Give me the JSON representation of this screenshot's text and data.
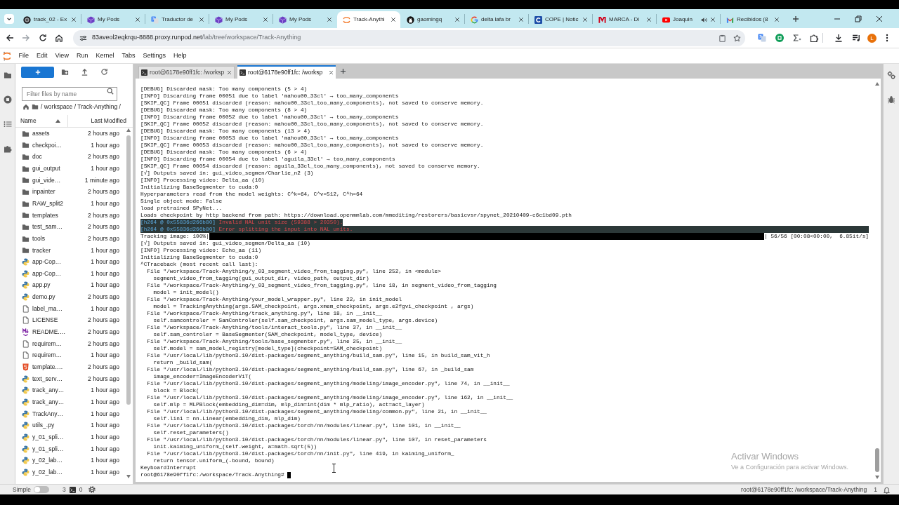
{
  "browser": {
    "tabs": [
      {
        "title": "track_02 - Ex",
        "kind": "disc",
        "selected": false,
        "audio": false
      },
      {
        "title": "My Pods",
        "kind": "cube",
        "selected": false,
        "audio": false
      },
      {
        "title": "Traductor de",
        "kind": "translate",
        "selected": false,
        "audio": false
      },
      {
        "title": "My Pods",
        "kind": "cube",
        "selected": false,
        "audio": false
      },
      {
        "title": "My Pods",
        "kind": "cube",
        "selected": false,
        "audio": false
      },
      {
        "title": "Track-Anythi",
        "kind": "arcs",
        "selected": true,
        "audio": false
      },
      {
        "title": "gaomingq",
        "kind": "cat",
        "selected": false,
        "audio": false
      },
      {
        "title": "delta lafa br",
        "kind": "g",
        "selected": false,
        "audio": false
      },
      {
        "title": "COPE | Notic",
        "kind": "c",
        "selected": false,
        "audio": false
      },
      {
        "title": "MARCA - Di",
        "kind": "m",
        "selected": false,
        "audio": false
      },
      {
        "title": "Joaquin",
        "kind": "play",
        "selected": false,
        "audio": true
      },
      {
        "title": "Recibidos (8",
        "kind": "envelope",
        "selected": false,
        "audio": false
      }
    ],
    "address": {
      "host": "83aveol2eqkrqu-8888.proxy.runpod.net",
      "path": "/lab/tree/workspace/Track-Anything"
    },
    "profile_initial": "L"
  },
  "menu": [
    "File",
    "Edit",
    "View",
    "Run",
    "Kernel",
    "Tabs",
    "Settings",
    "Help"
  ],
  "file_browser": {
    "filter_placeholder": "Filter files by name",
    "breadcrumb": "/ workspace / Track-Anything /",
    "columns": [
      {
        "label": "Name",
        "sorted": true
      },
      {
        "label": "Last Modified",
        "sorted": false
      }
    ],
    "files": [
      {
        "name": "assets",
        "kind": "folder",
        "modified": "2 hours ago"
      },
      {
        "name": "checkpoi…",
        "kind": "folder",
        "modified": "1 hour ago"
      },
      {
        "name": "doc",
        "kind": "folder",
        "modified": "2 hours ago"
      },
      {
        "name": "gui_output",
        "kind": "folder",
        "modified": "1 hour ago"
      },
      {
        "name": "gui_vide…",
        "kind": "folder",
        "modified": "1 minute ago"
      },
      {
        "name": "inpainter",
        "kind": "folder",
        "modified": "2 hours ago"
      },
      {
        "name": "RAW_split2",
        "kind": "folder",
        "modified": "1 hour ago"
      },
      {
        "name": "templates",
        "kind": "folder",
        "modified": "2 hours ago"
      },
      {
        "name": "test_sam…",
        "kind": "folder",
        "modified": "2 hours ago"
      },
      {
        "name": "tools",
        "kind": "folder",
        "modified": "2 hours ago"
      },
      {
        "name": "tracker",
        "kind": "folder",
        "modified": "1 hour ago"
      },
      {
        "name": "app-Cop…",
        "kind": "python",
        "modified": "1 hour ago"
      },
      {
        "name": "app-Cop…",
        "kind": "python",
        "modified": "1 hour ago"
      },
      {
        "name": "app.py",
        "kind": "python",
        "modified": "1 hour ago"
      },
      {
        "name": "demo.py",
        "kind": "python",
        "modified": "2 hours ago"
      },
      {
        "name": "label_ma…",
        "kind": "text",
        "modified": "1 hour ago"
      },
      {
        "name": "LICENSE",
        "kind": "text",
        "modified": "2 hours ago"
      },
      {
        "name": "README.…",
        "kind": "markdown",
        "modified": "2 hours ago"
      },
      {
        "name": "requirem…",
        "kind": "text",
        "modified": "2 hours ago"
      },
      {
        "name": "requirem…",
        "kind": "text",
        "modified": "1 hour ago"
      },
      {
        "name": "template.…",
        "kind": "html",
        "modified": "2 hours ago"
      },
      {
        "name": "text_serv…",
        "kind": "python",
        "modified": "2 hours ago"
      },
      {
        "name": "track_any…",
        "kind": "python",
        "modified": "1 hour ago"
      },
      {
        "name": "track_any…",
        "kind": "python",
        "modified": "1 hour ago"
      },
      {
        "name": "TrackAny…",
        "kind": "python",
        "modified": "1 hour ago"
      },
      {
        "name": "utils_.py",
        "kind": "python",
        "modified": "1 hour ago"
      },
      {
        "name": "y_01_spli…",
        "kind": "python",
        "modified": "1 hour ago"
      },
      {
        "name": "y_01_spli…",
        "kind": "python",
        "modified": "1 hour ago"
      },
      {
        "name": "y_02_lab…",
        "kind": "python",
        "modified": "1 hour ago"
      },
      {
        "name": "y_02_lab…",
        "kind": "python",
        "modified": "1 hour ago"
      }
    ]
  },
  "terminal_tabs": [
    {
      "title": "root@6178e90ff1fc: /worksp",
      "selected": false
    },
    {
      "title": "root@6178e90ff1fc: /worksp",
      "selected": true
    }
  ],
  "terminal": {
    "lines": [
      {
        "kind": "text",
        "text": "[DEBUG] Discarded mask: Too many components (5 > 4)"
      },
      {
        "kind": "text",
        "text": "[INFO] Discarding frame 00051 due to label 'mahou00_33cl' → too_many_components"
      },
      {
        "kind": "text",
        "text": "[SKIP_QC] Frame 00051 discarded (reason: mahou00_33cl_too_many_components), not saved to conserve memory."
      },
      {
        "kind": "text",
        "text": "[DEBUG] Discarded mask: Too many components (8 > 4)"
      },
      {
        "kind": "text",
        "text": "[INFO] Discarding frame 00052 due to label 'mahou00_33cl' → too_many_components"
      },
      {
        "kind": "text",
        "text": "[SKIP_QC] Frame 00052 discarded (reason: mahou00_33cl_too_many_components), not saved to conserve memory."
      },
      {
        "kind": "text",
        "text": "[DEBUG] Discarded mask: Too many components (13 > 4)"
      },
      {
        "kind": "text",
        "text": "[INFO] Discarding frame 00053 due to label 'mahou00_33cl' → too_many_components"
      },
      {
        "kind": "text",
        "text": "[SKIP_QC] Frame 00053 discarded (reason: mahou00_33cl_too_many_components), not saved to conserve memory."
      },
      {
        "kind": "text",
        "text": "[DEBUG] Discarded mask: Too many components (6 > 4)"
      },
      {
        "kind": "text",
        "text": "[INFO] Discarding frame 00054 due to label 'aguila_33cl' → too_many_components"
      },
      {
        "kind": "text",
        "text": "[SKIP_QC] Frame 00054 discarded (reason: aguila_33cl_too_many_components), not saved to conserve memory."
      },
      {
        "kind": "text",
        "text": "[√] Outputs saved in: gui_video_segmen/Charlie_n2 (3)"
      },
      {
        "kind": "text",
        "text": "[INFO] Processing video: Delta_aa (10)"
      },
      {
        "kind": "text",
        "text": "Initializing BaseSegmenter to cuda:0"
      },
      {
        "kind": "text",
        "text": "Hyperparameters read from the model weights: C^k=64, C^v=512, C^h=64"
      },
      {
        "kind": "text",
        "text": "Single object mode: False"
      },
      {
        "kind": "text",
        "text": "load pretrained SPyNet..."
      },
      {
        "kind": "text",
        "text": "Loads checkpoint by http backend from path: https://download.openmmlab.com/mmediting/restorers/basicvsr/spynet_20210409-c6c1bd09.pth"
      },
      {
        "kind": "error",
        "prefix": "[h264 @ 0x55836d266b80]",
        "message": "Invalid NAL unit size (59388 > 20350).",
        "band_full_width": false
      },
      {
        "kind": "error",
        "prefix": "[h264 @ 0x55836d266b80]",
        "message": "Error splitting the input into NAL units.",
        "band_full_width": true
      },
      {
        "kind": "progress",
        "label": "Tracking image: 100%|",
        "level": 1,
        "stats": "| 56/56 [00:08<00:00,  6.85it/s]"
      },
      {
        "kind": "text",
        "text": "[√] Outputs saved in: gui_video_segmen/Delta_aa (10)"
      },
      {
        "kind": "text",
        "text": "[INFO] Processing video: Echo_aa (11)"
      },
      {
        "kind": "text",
        "text": "Initializing BaseSegmenter to cuda:0"
      },
      {
        "kind": "text",
        "text": "^CTraceback (most recent call last):"
      },
      {
        "kind": "text",
        "text": "  File \"/workspace/Track-Anything/y_03_segment_video_from_tagging.py\", line 252, in <module>"
      },
      {
        "kind": "text",
        "text": "    segment_video_from_tagging(gui_output_dir, video_path, output_dir)"
      },
      {
        "kind": "text",
        "text": "  File \"/workspace/Track-Anything/y_03_segment_video_from_tagging.py\", line 18, in segment_video_from_tagging"
      },
      {
        "kind": "text",
        "text": "    model = init_model()"
      },
      {
        "kind": "text",
        "text": "  File \"/workspace/Track-Anything/your_model_wrapper.py\", line 22, in init_model"
      },
      {
        "kind": "text",
        "text": "    model = TrackingAnything(args.SAM_checkpoint, args.xmem_checkpoint, args.e2fgvi_checkpoint , args)"
      },
      {
        "kind": "text",
        "text": "  File \"/workspace/Track-Anything/track_anything.py\", line 18, in __init__"
      },
      {
        "kind": "text",
        "text": "    self.samcontroler = SamControler(self.sam_checkpoint, args.sam_model_type, args.device)"
      },
      {
        "kind": "text",
        "text": "  File \"/workspace/Track-Anything/tools/interact_tools.py\", line 37, in __init__"
      },
      {
        "kind": "text",
        "text": "    self.sam_controler = BaseSegmenter(SAM_checkpoint, model_type, device)"
      },
      {
        "kind": "text",
        "text": "  File \"/workspace/Track-Anything/tools/base_segmenter.py\", line 25, in __init__"
      },
      {
        "kind": "text",
        "text": "    self.model = sam_model_registry[model_type](checkpoint=SAM_checkpoint)"
      },
      {
        "kind": "text",
        "text": "  File \"/usr/local/lib/python3.10/dist-packages/segment_anything/build_sam.py\", line 15, in build_sam_vit_h"
      },
      {
        "kind": "text",
        "text": "    return _build_sam("
      },
      {
        "kind": "text",
        "text": "  File \"/usr/local/lib/python3.10/dist-packages/segment_anything/build_sam.py\", line 67, in _build_sam"
      },
      {
        "kind": "text",
        "text": "    image_encoder=ImageEncoderViT("
      },
      {
        "kind": "text",
        "text": "  File \"/usr/local/lib/python3.10/dist-packages/segment_anything/modeling/image_encoder.py\", line 74, in __init__"
      },
      {
        "kind": "text",
        "text": "    block = Block("
      },
      {
        "kind": "text",
        "text": "  File \"/usr/local/lib/python3.10/dist-packages/segment_anything/modeling/image_encoder.py\", line 162, in __init__"
      },
      {
        "kind": "text",
        "text": "    self.mlp = MLPBlock(embedding_dim=dim, mlp_dim=int(dim * mlp_ratio), act=act_layer)"
      },
      {
        "kind": "text",
        "text": "  File \"/usr/local/lib/python3.10/dist-packages/segment_anything/modeling/common.py\", line 21, in __init__"
      },
      {
        "kind": "text",
        "text": "    self.lin1 = nn.Linear(embedding_dim, mlp_dim)"
      },
      {
        "kind": "text",
        "text": "  File \"/usr/local/lib/python3.10/dist-packages/torch/nn/modules/linear.py\", line 101, in __init__"
      },
      {
        "kind": "text",
        "text": "    self.reset_parameters()"
      },
      {
        "kind": "text",
        "text": "  File \"/usr/local/lib/python3.10/dist-packages/torch/nn/modules/linear.py\", line 107, in reset_parameters"
      },
      {
        "kind": "text",
        "text": "    init.kaiming_uniform_(self.weight, a=math.sqrt(5))"
      },
      {
        "kind": "text",
        "text": "  File \"/usr/local/lib/python3.10/dist-packages/torch/nn/init.py\", line 419, in kaiming_uniform_"
      },
      {
        "kind": "text",
        "text": "    return tensor.uniform_(-bound, bound)"
      },
      {
        "kind": "text",
        "text": "KeyboardInterrupt"
      },
      {
        "kind": "prompt",
        "text": "root@6178e90ff1fc:/workspace/Track-Anything#"
      }
    ]
  },
  "status_bar": {
    "mode_label": "Simple",
    "simple_mode": false,
    "terminal_count": "3",
    "kernel_count": "0",
    "context": "root@6178e90ff1fc: /workspace/Track-Anything",
    "notification_count": "1"
  },
  "windows_notice": {
    "title": "Activar Windows",
    "message": "Ve a Configuración para activar Windows."
  }
}
